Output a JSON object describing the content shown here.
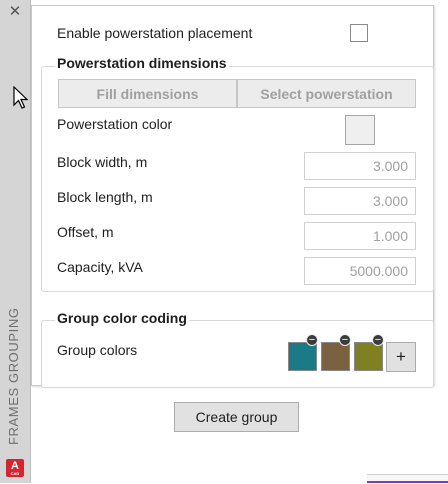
{
  "panel": {
    "vertical_title": "FRAMES GROUPING",
    "close_glyph": "✕",
    "app_icon": {
      "letter": "A",
      "sub": "CAD"
    }
  },
  "enable_placement": {
    "label": "Enable powerstation placement",
    "checked": false
  },
  "dimensions": {
    "title": "Powerstation dimensions",
    "fill_button": "Fill dimensions",
    "select_button": "Select powerstation",
    "color_label": "Powerstation color",
    "fields": [
      {
        "label": "Block width, m",
        "value": "3.000"
      },
      {
        "label": "Block length, m",
        "value": "3.000"
      },
      {
        "label": "Offset, m",
        "value": "1.000"
      },
      {
        "label": "Capacity, kVA",
        "value": "5000.000"
      }
    ]
  },
  "color_coding": {
    "title": "Group color coding",
    "label": "Group colors",
    "colors": [
      "#1a7b86",
      "#7a6140",
      "#7f8021"
    ],
    "remove_glyph": "−",
    "add_glyph": "+"
  },
  "actions": {
    "create_group": "Create group"
  },
  "colors": {
    "accent_purple": "#7b3fb3",
    "app_red": "#d6252e"
  }
}
